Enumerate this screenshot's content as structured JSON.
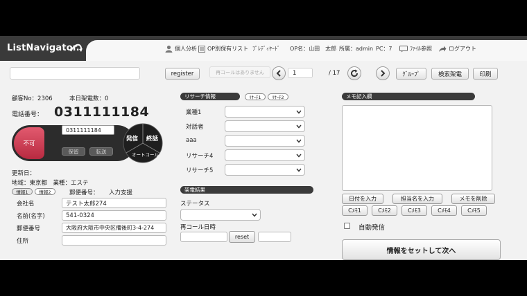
{
  "header": {
    "logo": "ListNavigator.",
    "nav": {
      "analysis": "個人分析",
      "op_list": "OP別保有リスト",
      "predial": "ﾌﾟﾚﾃﾞｨﾔｰﾄﾞ",
      "op_name": "OP名：山田　太郎",
      "affiliation": "所属：admin",
      "pc": "PC：7",
      "file_ref": "ﾌｧｲﾙ参照",
      "logout": "ログアウト"
    }
  },
  "toolbar": {
    "register": "register",
    "recall_notice": "再コールはありません",
    "page_current": "1",
    "page_total": "/ 17",
    "group": "ｸﾞﾙｰﾌﾟ",
    "search_call": "検索架電",
    "print": "印刷"
  },
  "customer": {
    "customer_no": "顧客No：2306",
    "today_calls": "本日架電数：0",
    "phone_label": "電話番号：",
    "phone_number": "0311111184",
    "dial_value": "0311111184",
    "ng": "不可",
    "hold": "保留",
    "transfer": "転送",
    "call": "発信",
    "end": "終話",
    "autocall": "オートコール",
    "updated": "更新日：",
    "region_industry": "地域：東京都　業種：エステ",
    "tab_info1": "情報1",
    "tab_info2": "情報2",
    "postal_link": "郵便番号：",
    "input_support": "入力支援",
    "fields": [
      {
        "label": "会社名",
        "value": "テスト太郎274"
      },
      {
        "label": "名前(名字)",
        "value": "541-0324"
      },
      {
        "label": "郵便番号",
        "value": "大阪府大阪市中央区備後町3-4-274"
      },
      {
        "label": "住所",
        "value": ""
      }
    ]
  },
  "research": {
    "header": "リサーチ情報",
    "tab1": "ﾘｻｰﾁ1",
    "tab2": "ﾘｻｰﾁ2",
    "rows": [
      {
        "label": "業種1",
        "value": ""
      },
      {
        "label": "対話者",
        "value": ""
      },
      {
        "label": "aaa",
        "value": ""
      },
      {
        "label": "リサーチ4",
        "value": ""
      },
      {
        "label": "リサーチ5",
        "value": ""
      }
    ]
  },
  "call_result": {
    "header": "架電結果",
    "status_label": "ステータス",
    "recall_label": "再コール日時",
    "reset": "reset"
  },
  "memo": {
    "header": "メモ記入欄",
    "date_btn": "日付を入力",
    "staff_btn": "担当名を入力",
    "delete_btn": "メモを削除",
    "cmemo": [
      "Cﾒﾓ1",
      "Cﾒﾓ2",
      "Cﾒﾓ3",
      "Cﾒﾓ4",
      "Cﾒﾓ5"
    ],
    "auto_dial": "自動発信",
    "set_next": "情報をセットして次へ"
  },
  "colors": {
    "header_dark": "#3a3a3a",
    "ng_red": "#c8324a",
    "panel_dark": "#3b3b3b"
  }
}
